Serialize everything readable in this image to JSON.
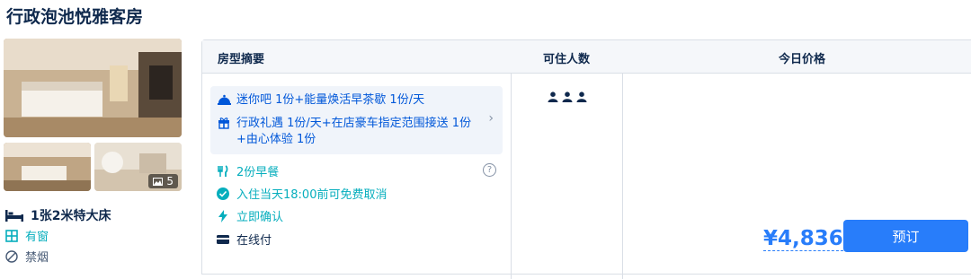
{
  "room": {
    "title": "行政泡池悦雅客房",
    "photo_count": "5",
    "bed": "1张2米特大床",
    "window": "有窗",
    "smoking": "禁烟"
  },
  "table": {
    "headers": [
      "房型摘要",
      "可住人数",
      "今日价格"
    ],
    "gifts": [
      {
        "icon": "room-service-icon",
        "text_lines": [
          "迷你吧 1份+能量焕活早茶歇 1份/天"
        ]
      },
      {
        "icon": "gift-icon",
        "text_lines": [
          "行政礼遇 1份/天+在店豪车指定范围接送 1份",
          "+由心体验 1份"
        ]
      }
    ],
    "features": [
      {
        "icon": "fork-knife-icon",
        "text": "2份早餐",
        "color": "#06aebd"
      },
      {
        "icon": "check-circle-icon",
        "text": "入住当天18:00前可免费取消",
        "color": "#06aebd"
      },
      {
        "icon": "lightning-icon",
        "text": "立即确认",
        "color": "#06aebd"
      },
      {
        "icon": "card-icon",
        "text": "在线付",
        "color": "#0f294d"
      }
    ],
    "help_symbol": "?",
    "occupancy": 3,
    "price": "¥4,836",
    "book_label": "预订"
  },
  "colors": {
    "accent": "#287dfa",
    "teal": "#06aebd",
    "text": "#0f294d",
    "border": "#dadfe6",
    "header_bg": "#f5f7fa",
    "gift_bg": "#f0f4fa"
  }
}
